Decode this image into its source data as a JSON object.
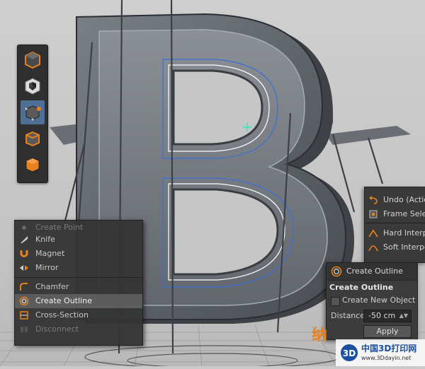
{
  "palette": {
    "tools": [
      {
        "name": "polygon-object"
      },
      {
        "name": "checker-texture"
      },
      {
        "name": "points-mode"
      },
      {
        "name": "edges-mode"
      },
      {
        "name": "polygons-mode"
      }
    ],
    "active_index": 2,
    "accent": "#e8821e"
  },
  "context_menu": {
    "items": [
      {
        "label": "Create Point",
        "icon": "create-point-icon",
        "dim": true
      },
      {
        "label": "Knife",
        "icon": "knife-icon",
        "dim": false
      },
      {
        "label": "Magnet",
        "icon": "magnet-icon",
        "dim": false
      },
      {
        "label": "Mirror",
        "icon": "mirror-icon",
        "dim": false
      },
      {
        "label": "Chamfer",
        "icon": "chamfer-icon",
        "dim": false
      },
      {
        "label": "Create Outline",
        "icon": "create-outline-icon",
        "dim": false,
        "highlighted": true
      },
      {
        "label": "Cross-Section",
        "icon": "cross-section-icon",
        "dim": false
      },
      {
        "label": "Disconnect",
        "icon": "disconnect-icon",
        "dim": true
      }
    ]
  },
  "spline_menu": {
    "items": [
      {
        "label": "Undo (Actio",
        "icon": "undo-icon"
      },
      {
        "label": "Frame Selec",
        "icon": "frame-selected-icon"
      },
      {
        "label": "Hard Interp",
        "icon": "hard-interpolation-icon"
      },
      {
        "label": "Soft Interpo",
        "icon": "soft-interpolation-icon"
      }
    ]
  },
  "tool_panel": {
    "header": "Create Outline",
    "section": "Create Outline",
    "create_new_object": "Create New Object",
    "create_new_object_checked": false,
    "distance_label": "Distance",
    "distance_value": "-50 cm",
    "apply_label": "Apply"
  },
  "watermark": {
    "cn": "中国3D打印网",
    "url": "www.3Ddayin.net"
  },
  "colors": {
    "viewport_bg": "#c9c9c9",
    "menu_bg": "#343434",
    "highlight": "#5c5c5c",
    "active_tool": "#4e6f96",
    "spline_blue": "#3a6fd8",
    "spline_white": "#ffffff",
    "cursor": "#2ee8c0"
  }
}
